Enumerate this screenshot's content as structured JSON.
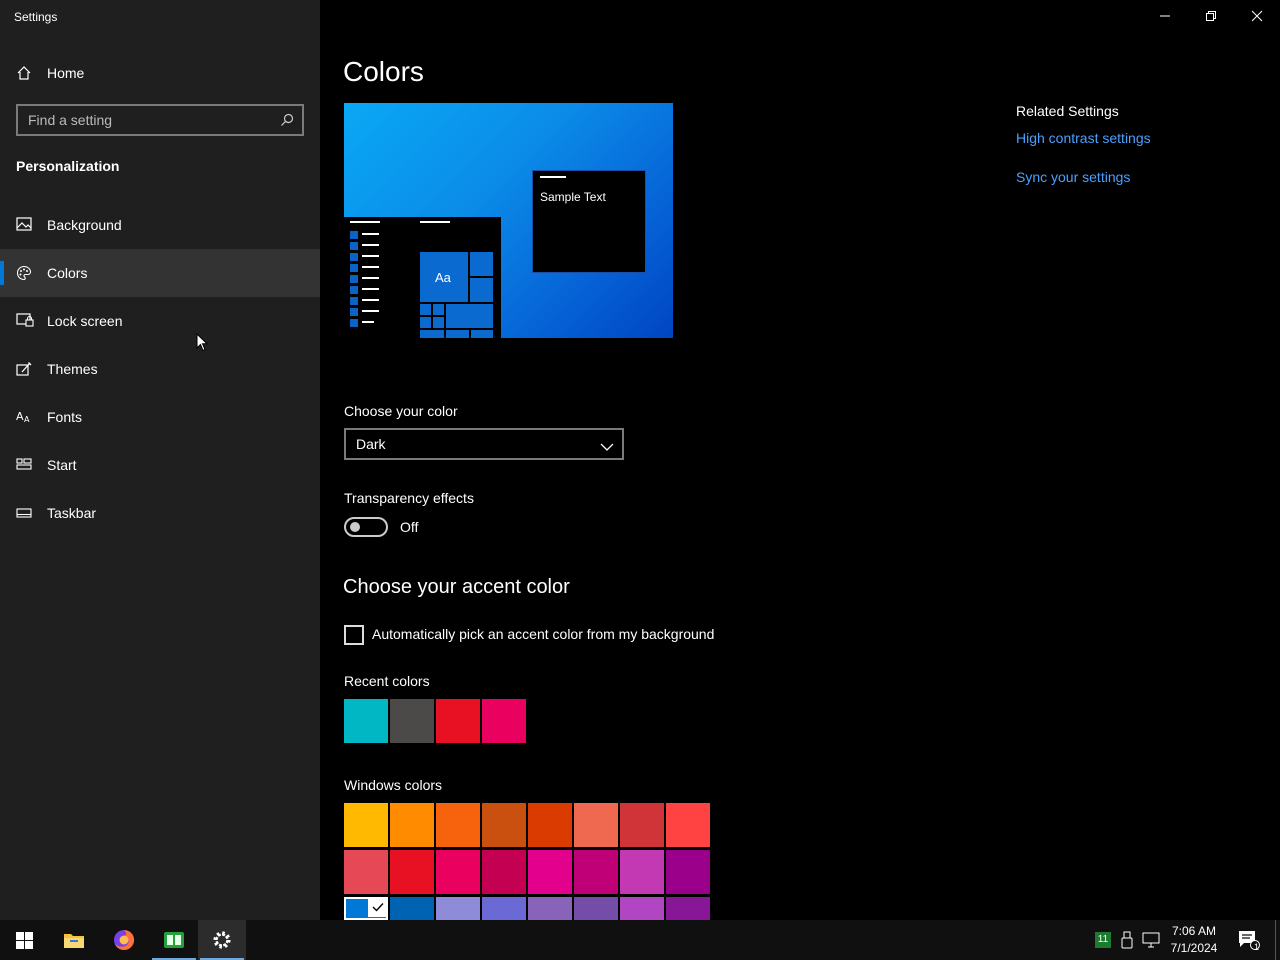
{
  "window": {
    "title": "Settings"
  },
  "sidebar": {
    "home_label": "Home",
    "search_placeholder": "Find a setting",
    "section_title": "Personalization",
    "items": [
      {
        "label": "Background",
        "icon": "picture-icon"
      },
      {
        "label": "Colors",
        "icon": "palette-icon",
        "selected": true
      },
      {
        "label": "Lock screen",
        "icon": "lock-screen-icon"
      },
      {
        "label": "Themes",
        "icon": "themes-icon"
      },
      {
        "label": "Fonts",
        "icon": "fonts-icon"
      },
      {
        "label": "Start",
        "icon": "start-icon"
      },
      {
        "label": "Taskbar",
        "icon": "taskbar-icon"
      }
    ]
  },
  "main": {
    "title": "Colors",
    "preview_sample_text": "Sample Text",
    "preview_tile_text": "Aa",
    "choose_color_label": "Choose your color",
    "choose_color_value": "Dark",
    "transparency_label": "Transparency effects",
    "transparency_state": "Off",
    "accent_title": "Choose your accent color",
    "auto_pick_label": "Automatically pick an accent color from my background",
    "recent_colors_label": "Recent colors",
    "recent_colors": [
      "#00b7c3",
      "#4c4a48",
      "#e81123",
      "#ea005e"
    ],
    "windows_colors_label": "Windows colors",
    "windows_colors": [
      [
        "#ffb900",
        "#ff8c00",
        "#f7630c",
        "#ca5010",
        "#da3b01",
        "#ef6950",
        "#d13438",
        "#ff4343"
      ],
      [
        "#e74856",
        "#e81123",
        "#ea005e",
        "#c30052",
        "#e3008c",
        "#bf0077",
        "#c239b3",
        "#9a0089"
      ],
      [
        "#0078d7",
        "#0063b1",
        "#8e8cd8",
        "#6b69d6",
        "#8764b8",
        "#744da9",
        "#b146c2",
        "#881798"
      ]
    ],
    "selected_color": "#0078d7"
  },
  "related": {
    "title": "Related Settings",
    "links": [
      "High contrast settings",
      "Sync your settings"
    ]
  },
  "taskbar": {
    "time": "7:06 AM",
    "date": "7/1/2024",
    "tray_badge": "11",
    "notification_count": "1"
  }
}
